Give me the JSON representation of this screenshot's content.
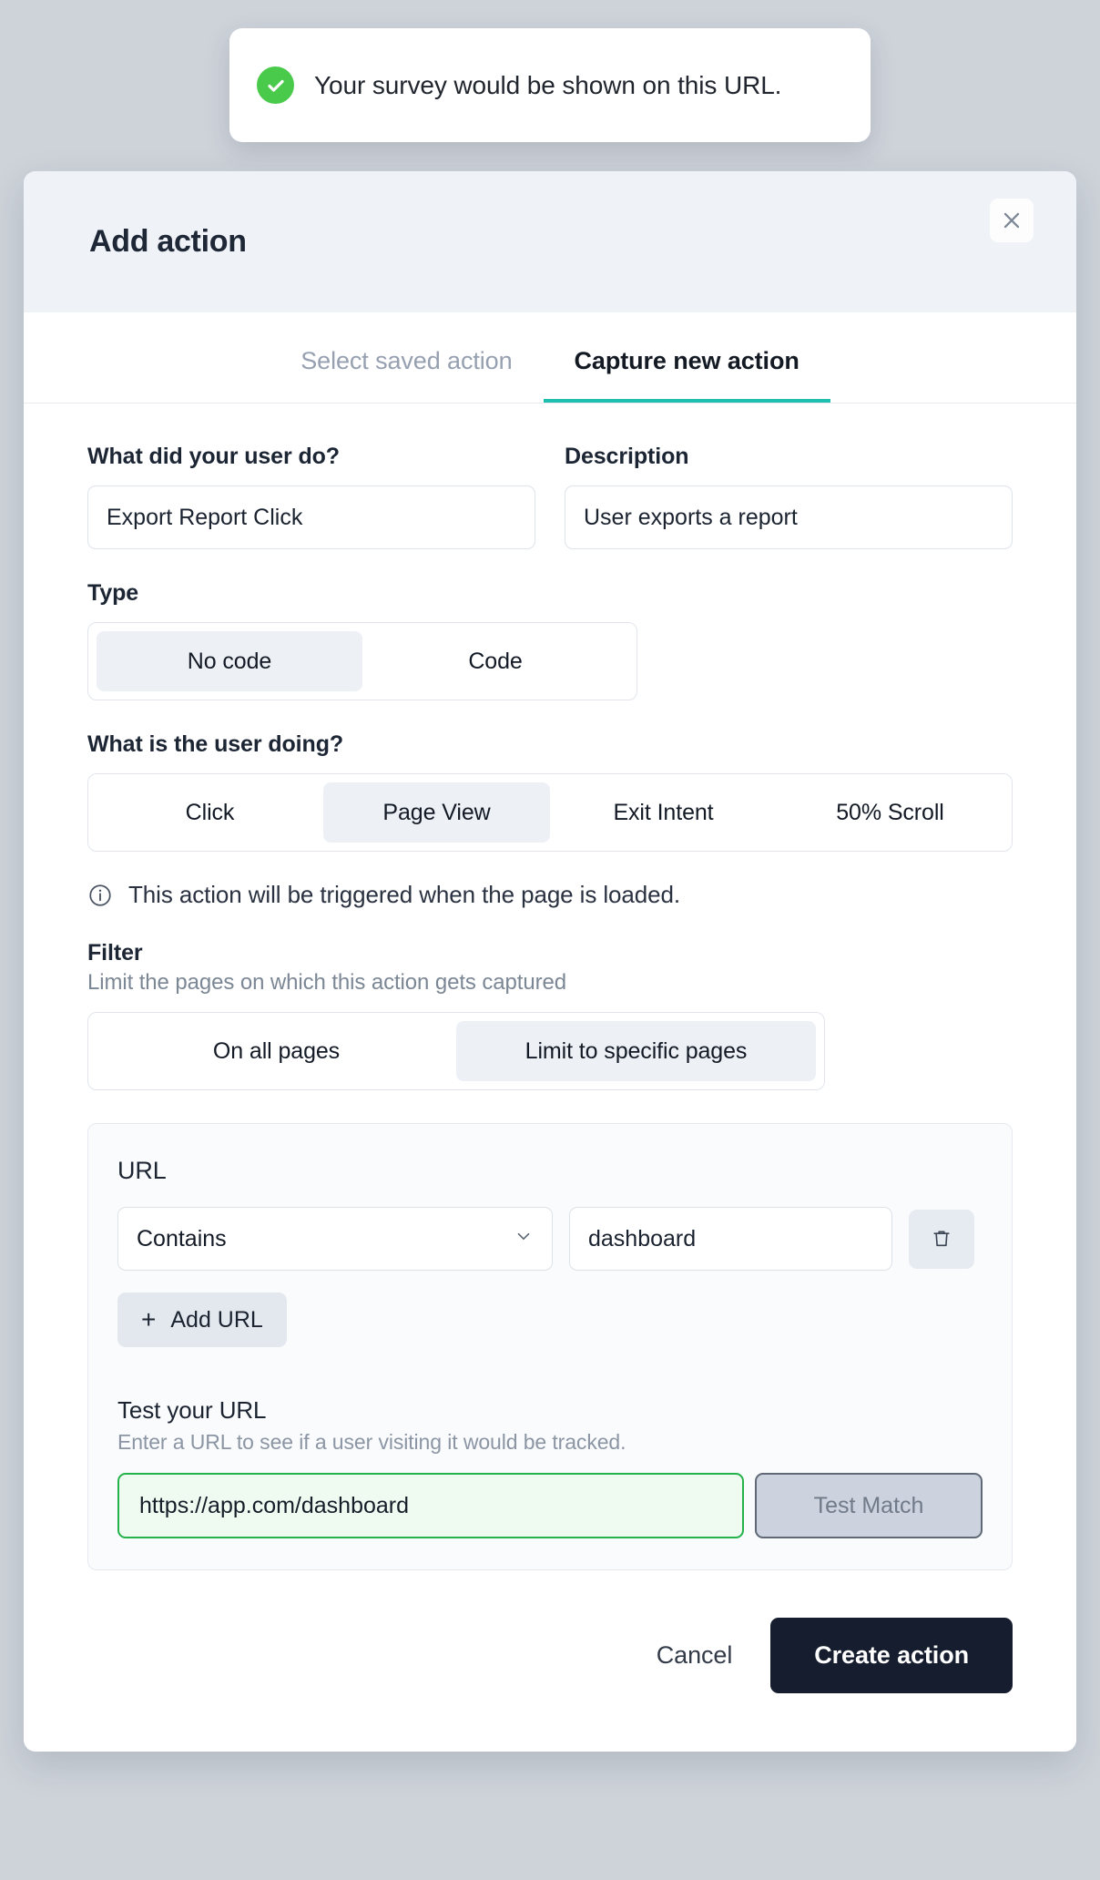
{
  "toast": {
    "icon": "check-circle-icon",
    "message": "Your survey would be shown on this URL.",
    "icon_color": "#49ca4b"
  },
  "modal": {
    "title": "Add action",
    "close_icon": "close-icon",
    "accent_color": "#1fbfb0",
    "tabs": [
      {
        "label": "Select saved action",
        "active": false
      },
      {
        "label": "Capture new action",
        "active": true
      }
    ],
    "fields": {
      "action_name": {
        "label": "What did your user do?",
        "value": "Export Report Click",
        "placeholder": "What did your user do?"
      },
      "description": {
        "label": "Description",
        "value": "User exports a report",
        "placeholder": "Description"
      }
    },
    "type": {
      "label": "Type",
      "options": [
        "No code",
        "Code"
      ],
      "selected": "No code"
    },
    "trigger": {
      "label": "What is the user doing?",
      "options": [
        "Click",
        "Page View",
        "Exit Intent",
        "50% Scroll"
      ],
      "selected": "Page View"
    },
    "info": {
      "icon": "info-icon",
      "text": "This action will be triggered when the page is loaded."
    },
    "filter": {
      "label": "Filter",
      "sub_label": "Limit the pages on which this action gets captured",
      "options": [
        "On all pages",
        "Limit to specific pages"
      ],
      "selected": "Limit to specific pages"
    },
    "url_card": {
      "title": "URL",
      "match_type": {
        "value": "Contains",
        "chevron_icon": "chevron-down-icon"
      },
      "url_value": {
        "value": "dashboard",
        "placeholder": "dashboard"
      },
      "delete_icon": "trash-icon",
      "add_url": {
        "label": "Add URL",
        "icon": "plus-icon"
      },
      "test": {
        "title": "Test your URL",
        "sub_title": "Enter a URL to see if a user visiting it would be tracked.",
        "input_value": "https://app.com/dashboard",
        "input_placeholder": "https://app.com/dashboard",
        "button_label": "Test Match",
        "input_border_color": "#26b24b"
      }
    },
    "footer": {
      "cancel_label": "Cancel",
      "create_label": "Create action"
    }
  }
}
